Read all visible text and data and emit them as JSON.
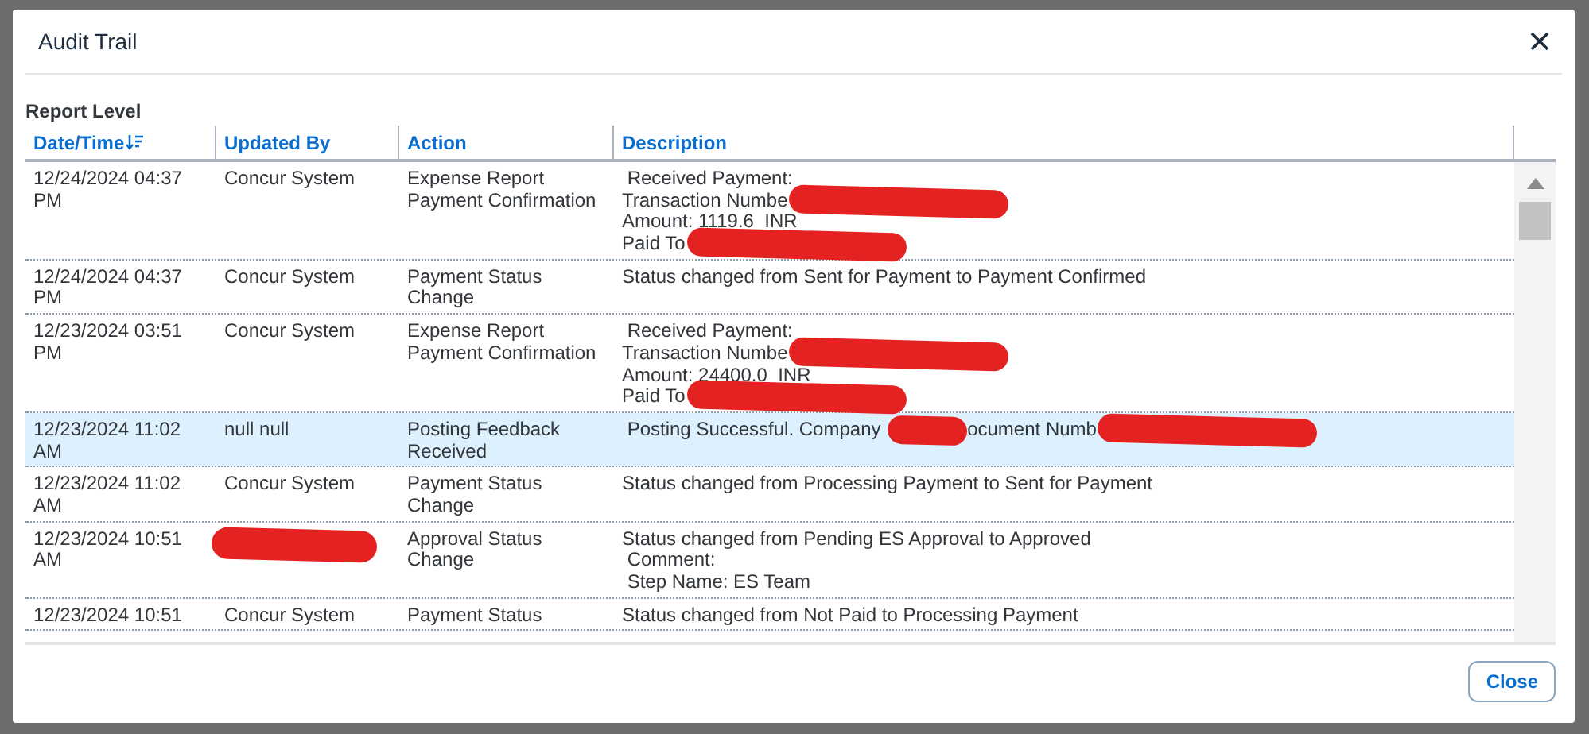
{
  "dialog": {
    "title": "Audit Trail",
    "section_title": "Report Level",
    "columns": [
      {
        "label": "Date/Time",
        "sorted": true
      },
      {
        "label": "Updated By",
        "sorted": false
      },
      {
        "label": "Action",
        "sorted": false
      },
      {
        "label": "Description",
        "sorted": false
      }
    ],
    "rows": [
      {
        "selected": false,
        "date": [
          "12/24/2024 04:37",
          "PM"
        ],
        "updated_by": [
          {
            "kind": "text",
            "text": "Concur System"
          }
        ],
        "action": [
          "Expense Report",
          "Payment Confirmation"
        ],
        "description": [
          [
            {
              "kind": "text",
              "text": " Received Payment:"
            }
          ],
          [
            {
              "kind": "text",
              "text": "Transaction Numbe"
            },
            {
              "kind": "redaction"
            }
          ],
          [
            {
              "kind": "text",
              "text": "Amount: 1119.6  INR"
            }
          ],
          [
            {
              "kind": "text",
              "text": "Paid To"
            },
            {
              "kind": "redaction"
            }
          ]
        ]
      },
      {
        "selected": false,
        "date": [
          "12/24/2024 04:37",
          "PM"
        ],
        "updated_by": [
          {
            "kind": "text",
            "text": "Concur System"
          }
        ],
        "action": [
          "Payment Status",
          "Change"
        ],
        "description": [
          [
            {
              "kind": "text",
              "text": "Status changed from Sent for Payment to Payment Confirmed"
            }
          ]
        ]
      },
      {
        "selected": false,
        "date": [
          "12/23/2024 03:51",
          "PM"
        ],
        "updated_by": [
          {
            "kind": "text",
            "text": "Concur System"
          }
        ],
        "action": [
          "Expense Report",
          "Payment Confirmation"
        ],
        "description": [
          [
            {
              "kind": "text",
              "text": " Received Payment:"
            }
          ],
          [
            {
              "kind": "text",
              "text": "Transaction Numbe"
            },
            {
              "kind": "redaction"
            }
          ],
          [
            {
              "kind": "text",
              "text": "Amount: 24400.0  INR"
            }
          ],
          [
            {
              "kind": "text",
              "text": "Paid To"
            },
            {
              "kind": "redaction"
            }
          ]
        ]
      },
      {
        "selected": true,
        "date": [
          "12/23/2024 11:02",
          "AM"
        ],
        "updated_by": [
          {
            "kind": "text",
            "text": "null null"
          }
        ],
        "action": [
          "Posting Feedback",
          "Received"
        ],
        "description": [
          [
            {
              "kind": "text",
              "text": " Posting Successful. Company "
            },
            {
              "kind": "redaction"
            },
            {
              "kind": "text",
              "text": "ocument Numb"
            },
            {
              "kind": "redaction"
            }
          ]
        ]
      },
      {
        "selected": false,
        "date": [
          "12/23/2024 11:02",
          "AM"
        ],
        "updated_by": [
          {
            "kind": "text",
            "text": "Concur System"
          }
        ],
        "action": [
          "Payment Status",
          "Change"
        ],
        "description": [
          [
            {
              "kind": "text",
              "text": "Status changed from Processing Payment to Sent for Payment"
            }
          ]
        ]
      },
      {
        "selected": false,
        "date": [
          "12/23/2024 10:51",
          "AM"
        ],
        "updated_by": [
          {
            "kind": "redaction"
          }
        ],
        "action": [
          "Approval Status",
          "Change"
        ],
        "description": [
          [
            {
              "kind": "text",
              "text": "Status changed from Pending ES Approval to Approved"
            }
          ],
          [
            {
              "kind": "text",
              "text": " Comment:"
            }
          ],
          [
            {
              "kind": "text",
              "text": " Step Name: ES Team"
            }
          ]
        ]
      },
      {
        "selected": false,
        "date": [
          "12/23/2024 10:51"
        ],
        "updated_by": [
          {
            "kind": "text",
            "text": "Concur System"
          }
        ],
        "action": [
          "Payment Status"
        ],
        "description": [
          [
            {
              "kind": "text",
              "text": "Status changed from Not Paid to Processing Payment"
            }
          ]
        ]
      }
    ],
    "buttons": [
      {
        "label": "Close"
      }
    ]
  }
}
